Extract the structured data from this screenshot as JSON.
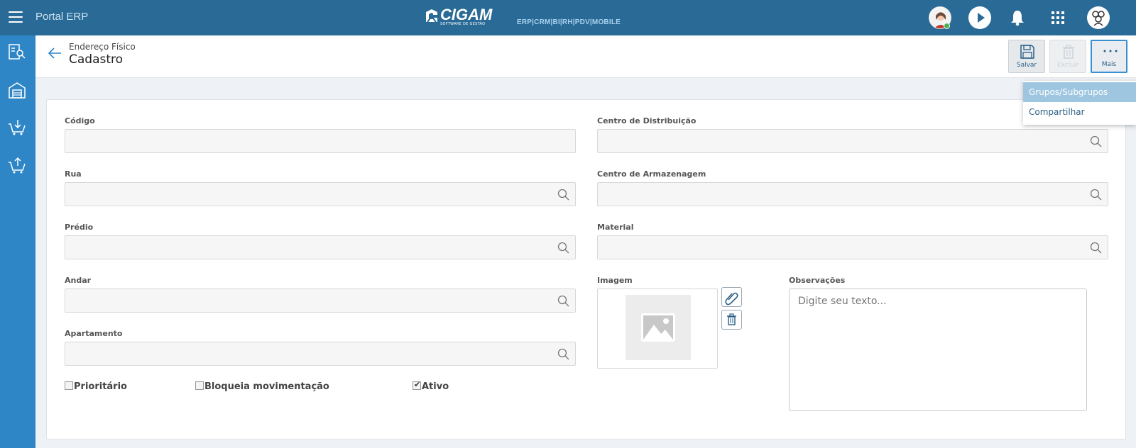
{
  "topbar": {
    "app_title": "Portal ERP",
    "logo_word": "CIGAM",
    "logo_sub": "SOFTWARE DE GESTÃO",
    "logo_products": "ERP|CRM|BI|RH|PDV|MOBILE",
    "icons": [
      "menu-icon",
      "user-avatar",
      "play-icon",
      "bell-icon",
      "apps-grid-icon",
      "company-avatar"
    ]
  },
  "sidebar": {
    "items": [
      "inventory-search-icon",
      "warehouse-icon",
      "cart-in-icon",
      "cart-out-icon"
    ]
  },
  "header": {
    "breadcrumb": "Endereço Físico",
    "title": "Cadastro"
  },
  "toolbar": {
    "save_label": "Salvar",
    "delete_label": "Excluir",
    "more_label": "Mais"
  },
  "more_menu": {
    "items": [
      "Grupos/Subgrupos",
      "Compartilhar"
    ],
    "highlighted": "Grupos/Subgrupos"
  },
  "form": {
    "codigo": {
      "label": "Código",
      "value": ""
    },
    "rua": {
      "label": "Rua",
      "value": ""
    },
    "predio": {
      "label": "Prédio",
      "value": ""
    },
    "andar": {
      "label": "Andar",
      "value": ""
    },
    "apartamento": {
      "label": "Apartamento",
      "value": ""
    },
    "centro_distribuicao": {
      "label": "Centro de Distribuição",
      "value": ""
    },
    "centro_armazenagem": {
      "label": "Centro de Armazenagem",
      "value": ""
    },
    "material": {
      "label": "Material",
      "value": ""
    },
    "imagem": {
      "label": "Imagem"
    },
    "observacoes": {
      "label": "Observações",
      "placeholder": "Digite seu texto..."
    },
    "checkboxes": {
      "prioritario": {
        "label": "Prioritário",
        "checked": false
      },
      "bloqueia": {
        "label": "Bloqueia movimentação",
        "checked": false
      },
      "ativo": {
        "label": "Ativo",
        "checked": true
      }
    }
  },
  "colors": {
    "topbar": "#296a96",
    "sidebar": "#2f86c6",
    "accent": "#2a5f85",
    "menu_highlight": "#9ec6e1"
  }
}
